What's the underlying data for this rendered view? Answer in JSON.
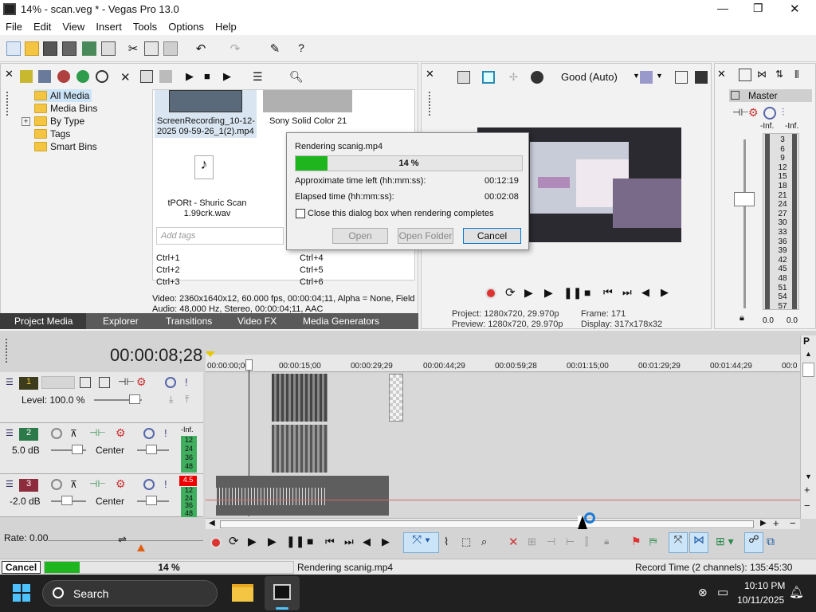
{
  "window": {
    "title": "14% - scan.veg * - Vegas Pro 13.0",
    "minimize": "—",
    "maximize": "❐",
    "close": "✕"
  },
  "menu": [
    "File",
    "Edit",
    "View",
    "Insert",
    "Tools",
    "Options",
    "Help"
  ],
  "explorer": {
    "tree": [
      "All Media",
      "Media Bins",
      "By Type",
      "Tags",
      "Smart Bins"
    ],
    "thumbs": [
      {
        "label": "ScreenRecording_10-12-2025 09-59-26_1(2).mp4"
      },
      {
        "label": "Sony Solid Color 21"
      },
      {
        "label": "tPORt - Shuric Scan 1.99crk.wav"
      }
    ],
    "tags_placeholder": "Add tags",
    "shortcuts_left": [
      "Ctrl+1",
      "Ctrl+2",
      "Ctrl+3"
    ],
    "shortcuts_right": [
      "Ctrl+4",
      "Ctrl+5",
      "Ctrl+6"
    ],
    "video_info": "Video: 2360x1640x12, 60.000 fps, 00:00:04;11, Alpha = None, Field",
    "audio_info": "Audio: 48,000 Hz, Stereo, 00:00:04;11, AAC"
  },
  "dock_tabs": [
    "Project Media",
    "Explorer",
    "Transitions",
    "Video FX",
    "Media Generators"
  ],
  "preview": {
    "quality": "Good (Auto)",
    "project": "Project:  1280x720, 29.970p",
    "preview_res": "Preview:  1280x720, 29.970p",
    "frame": "Frame:     171",
    "display": "Display:   317x178x32"
  },
  "master": {
    "title": "Master",
    "left_label": "-Inf.",
    "right_label": "-Inf.",
    "scale": [
      "3",
      "6",
      "9",
      "12",
      "15",
      "18",
      "21",
      "24",
      "27",
      "30",
      "33",
      "36",
      "39",
      "42",
      "45",
      "48",
      "51",
      "54",
      "57"
    ],
    "bottom_left": "0.0",
    "bottom_right": "0.0"
  },
  "render": {
    "title": "Rendering scanig.mp4",
    "percent": "14 %",
    "progress": 0.14,
    "time_left_label": "Approximate time left (hh:mm:ss):",
    "time_left": "00:12:19",
    "elapsed_label": "Elapsed time (hh:mm:ss):",
    "elapsed": "00:02:08",
    "close_label": "Close this dialog box when rendering completes",
    "open": "Open",
    "open_folder": "Open Folder",
    "cancel": "Cancel"
  },
  "timeline": {
    "timecode": "00:00:08;28",
    "ruler": [
      "00:00:00;00",
      "00:00:15;00",
      "00:00:29;29",
      "00:00:44;29",
      "00:00:59;28",
      "00:01:15;00",
      "00:01:29;29",
      "00:01:44;29",
      "00:0"
    ],
    "tracks": [
      {
        "num": "1",
        "level": "Level: 100.0 %",
        "color": "#3c3c1c"
      },
      {
        "num": "2",
        "vol": "5.0 dB",
        "pan": "Center",
        "peak": "-Inf.",
        "color": "#2c7a4a"
      },
      {
        "num": "3",
        "vol": "-2.0 dB",
        "pan": "Center",
        "peak": "4.5",
        "color": "#8c2c3c"
      }
    ],
    "meter_small": [
      "12",
      "24",
      "36",
      "48"
    ]
  },
  "rate": "Rate: 0.00",
  "status": {
    "cancel": "Cancel",
    "percent": "14 %",
    "progress": 0.14,
    "message": "Rendering scanig.mp4",
    "record_time": "Record Time (2 channels): 135:45:30"
  },
  "taskbar": {
    "search": "Search",
    "time": "10:10 PM",
    "date": "10/11/2025"
  },
  "colors": {
    "progress_green": "#1fb51f",
    "accent_blue": "#0078d7",
    "track1": "#3c3c1c",
    "track2": "#2c7a4a",
    "track3": "#8c2c3c"
  }
}
